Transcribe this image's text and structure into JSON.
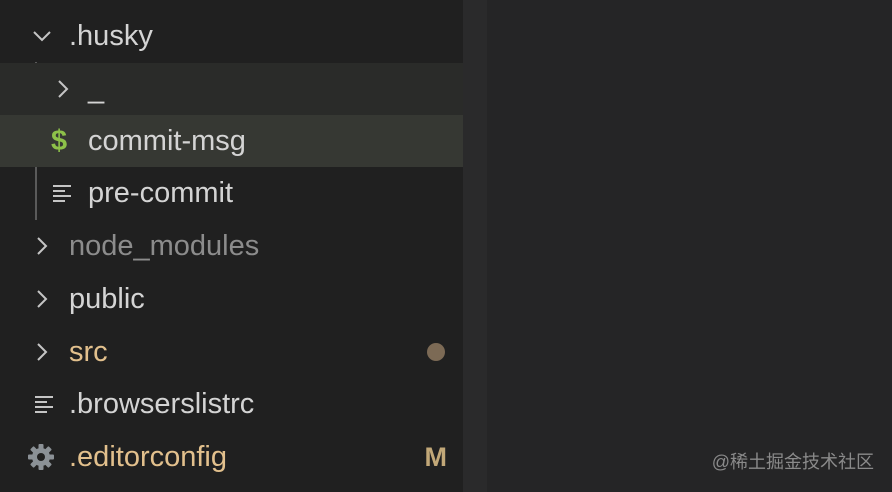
{
  "explorer": {
    "items": [
      {
        "label": ".husky",
        "kind": "folder-open",
        "color": "#d4d4d4"
      },
      {
        "label": "_",
        "kind": "folder-closed",
        "color": "#d4d4d4"
      },
      {
        "label": "commit-msg",
        "kind": "shell-file",
        "icon_glyph": "$",
        "color": "#d4d4d4",
        "icon_color": "#8dc149"
      },
      {
        "label": "pre-commit",
        "kind": "text-file",
        "color": "#d4d4d4"
      },
      {
        "label": "node_modules",
        "kind": "folder-closed",
        "color": "#8c8c8c"
      },
      {
        "label": "public",
        "kind": "folder-closed",
        "color": "#d4d4d4"
      },
      {
        "label": "src",
        "kind": "folder-closed",
        "color": "#e2c08d",
        "decoration": "modified-dot",
        "decoration_color": "#7c6a55"
      },
      {
        "label": ".browserslistrc",
        "kind": "text-file",
        "color": "#d4d4d4"
      },
      {
        "label": ".editorconfig",
        "kind": "settings-file",
        "color": "#e2c08d",
        "badge": "M",
        "badge_color": "#c2a878"
      }
    ]
  },
  "colors": {
    "sidebar_bg": "#202020",
    "editor_bg": "#252526",
    "selected_row_bg": "#363833",
    "hover_row_bg": "#2a2b29",
    "chevron": "#c5c5c5",
    "gear": "#8b9196"
  },
  "watermark": {
    "text": "@稀土掘金技术社区"
  }
}
